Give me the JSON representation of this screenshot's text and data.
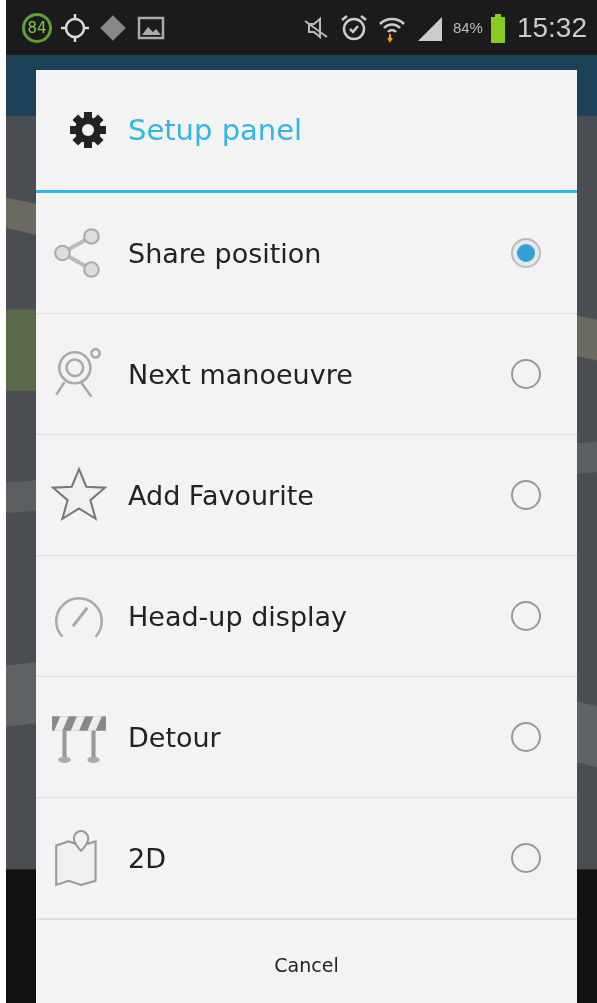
{
  "status_bar": {
    "badge": "84",
    "battery": "84%",
    "time": "15:32"
  },
  "dialog": {
    "title": "Setup panel",
    "options": [
      {
        "kind": "share",
        "label": "Share position",
        "selected": true
      },
      {
        "kind": "manoeuvre",
        "label": "Next manoeuvre",
        "selected": false
      },
      {
        "kind": "favourite",
        "label": "Add Favourite",
        "selected": false
      },
      {
        "kind": "hud",
        "label": "Head-up display",
        "selected": false
      },
      {
        "kind": "detour",
        "label": "Detour",
        "selected": false
      },
      {
        "kind": "map2d",
        "label": "2D",
        "selected": false
      }
    ],
    "cancel": "Cancel"
  }
}
